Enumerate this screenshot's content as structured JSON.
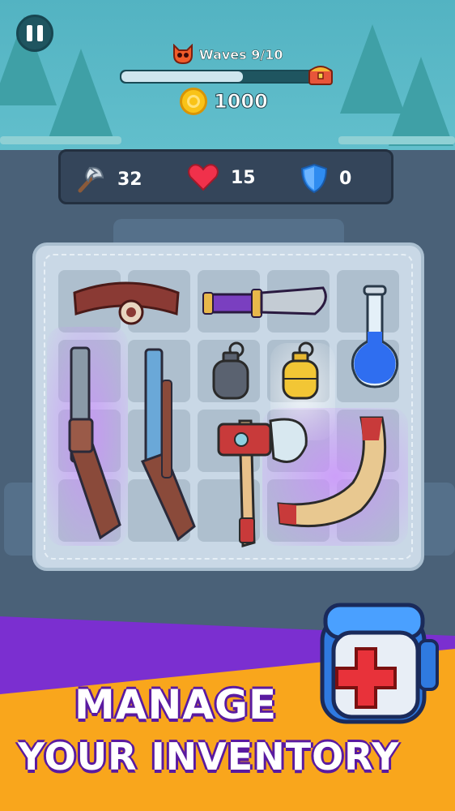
{
  "hud": {
    "wave_label": "Waves 9/10",
    "wave_progress": 0.6,
    "coins": "1000"
  },
  "stats": {
    "attack": "32",
    "health": "15",
    "shield": "0"
  },
  "inventory": {
    "items": [
      "belt",
      "knife",
      "potion",
      "shotgun",
      "rifle",
      "grenade",
      "grenade-gold",
      "axe",
      "boomerang"
    ]
  },
  "banner": {
    "line1": "MANAGE",
    "line2": "YOUR INVENTORY"
  },
  "colors": {
    "banner_purple": "#7b2fd0",
    "banner_orange": "#f9a61c",
    "sky": "#5fb8c8"
  }
}
